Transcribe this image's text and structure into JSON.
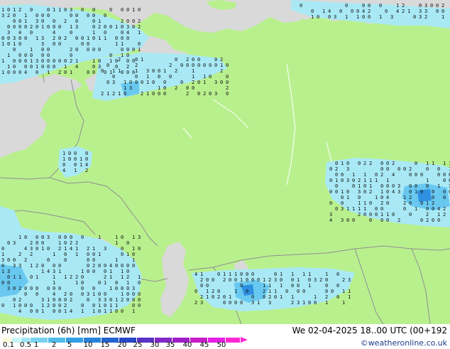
{
  "map": {
    "precip_areas": "light-blue shading of 6-hour precipitation over northern Scandinavia, Baltic region, Caucasus/Black Sea area and central Siberia",
    "grid_values_sample": [
      "0",
      "1",
      "2",
      "3",
      "4",
      "5",
      "6"
    ],
    "colors": {
      "land": "#b9f08e",
      "sea": "#d9d9d9",
      "lake": "#d9d9d9",
      "border": "#8f8f8f",
      "precip_light": "#a9e9f5",
      "precip_mid": "#68c8f0",
      "precip_strong": "#2f8fe0"
    }
  },
  "footer": {
    "title": "Precipitation (6h) [mm] ECMWF",
    "valid_time": "We 02-04-2025 18..00 UTC (00+192",
    "credit": "©weatheronline.co.uk",
    "scale_labels": [
      "0.1",
      "0.5",
      "1",
      "2",
      "5",
      "10",
      "15",
      "20",
      "25",
      "30",
      "35",
      "40",
      "45",
      "50"
    ],
    "scale_colors": [
      "#fafadc",
      "#c8f5f5",
      "#a0e6f5",
      "#78d2f0",
      "#50bcec",
      "#32a0e6",
      "#2882dc",
      "#2464d2",
      "#2846c8",
      "#5a32c8",
      "#8228c8",
      "#a01ec8",
      "#c81ec8",
      "#e61ee6",
      "#ff28d2"
    ]
  }
}
